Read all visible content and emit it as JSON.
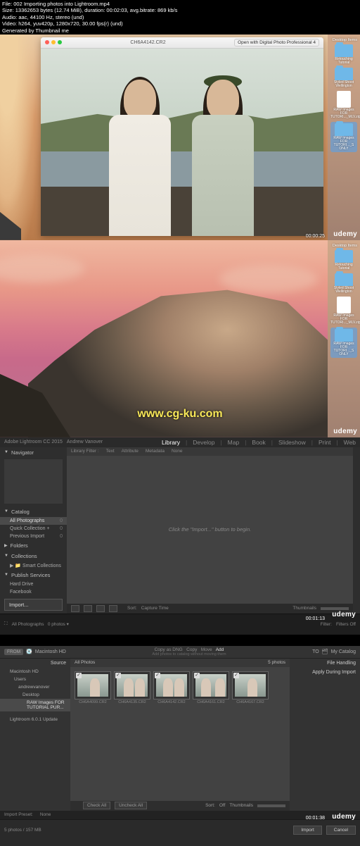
{
  "meta": {
    "line1": "File: 002 Importing photos into Lightroom.mp4",
    "line2": "Size: 13362653 bytes (12.74 MiB), duration: 00:02:03, avg.bitrate: 869 kb/s",
    "line3": "Audio: aac, 44100 Hz, stereo (und)",
    "line4": "Video: h264, yuv420p, 1280x720, 30.00 fps(r) (und)",
    "line5": "Generated by Thumbnail me"
  },
  "brand": "udemy",
  "watermark": "www.cg-ku.com",
  "scr1": {
    "window_title": "CH6A4142.CR2",
    "open_with": "Open with Digital Photo Professional 4",
    "timestamp": "00:00:25",
    "desktop_header": "Desktop Items",
    "desktop_items": [
      {
        "type": "folder",
        "label": "Retouching Tutorial"
      },
      {
        "type": "folder",
        "label": "Styled Shoot Wellington"
      },
      {
        "type": "file",
        "label": "RAW Images FOR TUTORI..._MLV.zip"
      },
      {
        "type": "folder",
        "label": "RAW Images FOR TUTORI..._S ONLY",
        "selected": true
      }
    ]
  },
  "scr2": {
    "desktop_header": "Desktop Items",
    "desktop_items": [
      {
        "type": "folder",
        "label": "Retouching Tutorial"
      },
      {
        "type": "folder",
        "label": "Styled Shoot Wellington"
      },
      {
        "type": "file",
        "label": "RAW Images FOR TUTORI..._MLV.zip"
      },
      {
        "type": "folder",
        "label": "RAW Images FOR TUTORI..._S ONLY",
        "selected": true
      }
    ]
  },
  "scr3": {
    "brand": "Adobe Lightroom CC 2015",
    "user": "Andrew Vanover",
    "modules": [
      "Library",
      "Develop",
      "Map",
      "Book",
      "Slideshow",
      "Print",
      "Web"
    ],
    "active_module": "Library",
    "navigator_label": "Navigator",
    "catalog_label": "Catalog",
    "catalog_items": [
      {
        "label": "All Photographs",
        "count": "0",
        "selected": true
      },
      {
        "label": "Quick Collection +",
        "count": "0"
      },
      {
        "label": "Previous Import",
        "count": "0"
      }
    ],
    "folders_label": "Folders",
    "collections_label": "Collections",
    "collections_items": [
      {
        "label": "Smart Collections"
      }
    ],
    "publish_label": "Publish Services",
    "publish_items": [
      {
        "label": "Hard Drive"
      },
      {
        "label": "Facebook"
      }
    ],
    "import_btn": "Import...",
    "filter_labels": [
      "Library Filter :",
      "Text",
      "Attribute",
      "Metadata",
      "None"
    ],
    "empty_msg": "Click the \"Import...\" button to begin.",
    "sort_label": "Sort:",
    "sort_value": "Capture Time",
    "thumbnails_label": "Thumbnails",
    "filmstrip_path": "All Photographs",
    "filmstrip_count": "0 photos ▾",
    "filmstrip_filter": "Filter:",
    "filmstrip_off": "Filters Off",
    "timestamp": "00:01:13"
  },
  "scr4": {
    "from_label": "FROM",
    "from_source": "Macintosh HD",
    "copy_modes": [
      "Copy as DNG",
      "Copy",
      "Move",
      "Add"
    ],
    "copy_active": "Add",
    "copy_sub": "Add photos to catalog without moving them",
    "to_label": "TO",
    "to_dest": "My Catalog",
    "source_hdr": "Source",
    "source_tree": [
      {
        "label": "Macintosh HD"
      },
      {
        "label": "Users",
        "indent": 1
      },
      {
        "label": "andrewvanover",
        "indent": 2
      },
      {
        "label": "Desktop",
        "indent": 3
      },
      {
        "label": "RAW Images FOR TUTORIAL PUR...",
        "indent": 4,
        "selected": true
      },
      {
        "label": "Lightroom 6.0.1 Update"
      }
    ],
    "tab_all": "All Photos",
    "tab_count": "5 photos",
    "thumbs": [
      {
        "caption": "CH6A4099.CR2"
      },
      {
        "caption": "CH6A4135.CR2"
      },
      {
        "caption": "CH6A4142.CR2"
      },
      {
        "caption": "CH6A4161.CR2"
      },
      {
        "caption": "CH6A4167.CR2"
      }
    ],
    "check_all": "Check All",
    "uncheck_all": "Uncheck All",
    "sort_label": "Sort:",
    "sort_value": "Off",
    "thumbnails_label": "Thumbnails",
    "right_panels": [
      "File Handling",
      "Apply During Import"
    ],
    "preset_label": "Import Preset:",
    "preset_value": "None",
    "import_btn": "Import",
    "cancel_btn": "Cancel",
    "bottom_count": "5 photos / 157 MB",
    "timestamp": "00:01:38"
  }
}
